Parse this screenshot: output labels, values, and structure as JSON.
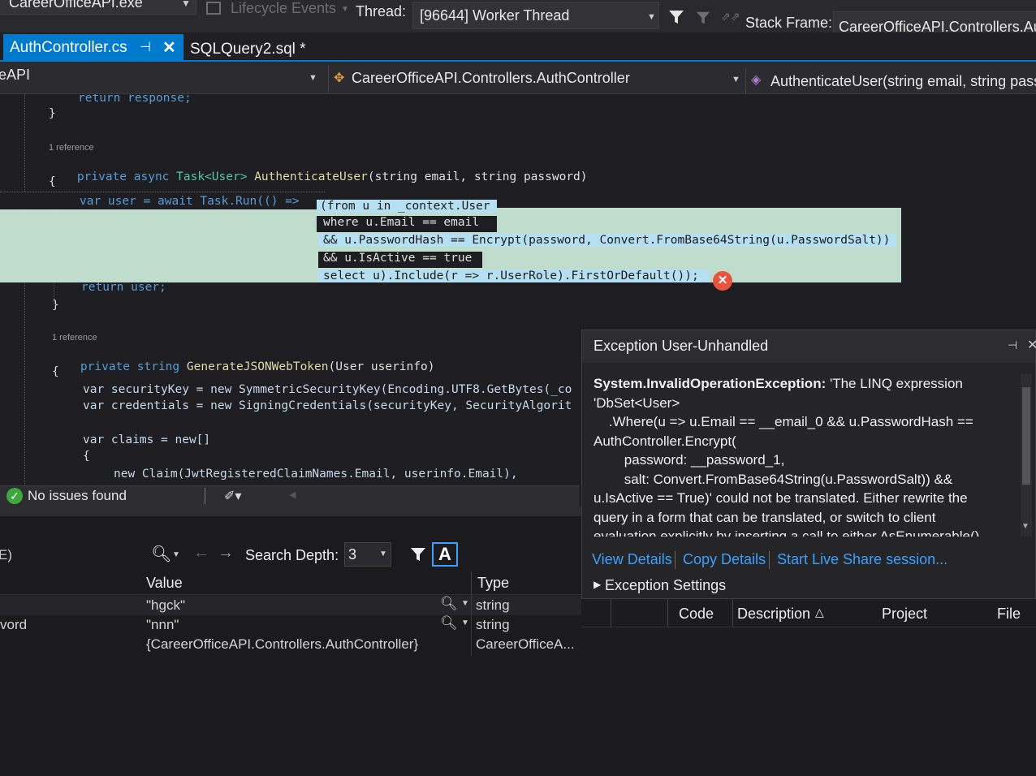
{
  "toolbar": {
    "process": "CareerOfficeAPI.exe",
    "lifecycle_label": "Lifecycle Events",
    "thread_label": "Thread:",
    "thread_value": "[96644] Worker Thread",
    "stack_frame_label": "Stack Frame:",
    "stack_frame_value": "CareerOfficeAPI.Controllers.Auth"
  },
  "tabs": [
    {
      "label": "AuthController.cs",
      "active": true
    },
    {
      "label": "SQLQuery2.sql *",
      "active": false
    }
  ],
  "navbar": {
    "project": "eAPI",
    "class_path": "CareerOfficeAPI.Controllers.AuthController",
    "member": "AuthenticateUser(string email, string passw"
  },
  "code": {
    "return_response": "return response;",
    "brace_close": "}",
    "brace_open": "{",
    "ref_1": "1 reference",
    "auth_sig": {
      "kw_private": "private",
      "kw_async": "async",
      "task_type": "Task<User>",
      "name": "AuthenticateUser",
      "params": "(string email, string password)"
    },
    "line_var_user": "var user = await Task.Run(() =>",
    "line_from": "(from u in _context.User",
    "line_where": "where u.Email == email",
    "line_pwd": "&& u.PasswordHash == Encrypt(password, Convert.FromBase64String(u.PasswordSalt))",
    "line_active": "&& u.IsActive == true",
    "line_select": "select u).Include(r => r.UserRole).FirstOrDefault());",
    "return_user": "return user;",
    "ref_2": "1 reference",
    "gen_sig": {
      "kw_private": "private",
      "kw_string": "string",
      "name": "GenerateJSONWebToken",
      "params": "(User userinfo)"
    },
    "line_seckey": "var securityKey = new SymmetricSecurityKey(Encoding.UTF8.GetBytes(_co",
    "line_creds": "var credentials = new SigningCredentials(securityKey, SecurityAlgorit",
    "line_claims": "var claims = new[]",
    "line_claim_email": "new Claim(JwtRegisteredClaimNames.Email, userinfo.Email),"
  },
  "status": {
    "issues": "No issues found"
  },
  "locals": {
    "search_depth_label": "Search Depth:",
    "search_depth_value": "3",
    "partial_left": "E)",
    "col_value": "Value",
    "col_type": "Type",
    "rows": [
      {
        "name": "",
        "value": "\"hgck\"",
        "type": "string"
      },
      {
        "name": "vord",
        "value": "\"nnn\"",
        "type": "string"
      },
      {
        "name": "",
        "value": "{CareerOfficeAPI.Controllers.AuthController}",
        "type": "CareerOfficeA..."
      }
    ]
  },
  "exception": {
    "title": "Exception User-Unhandled",
    "type": "System.InvalidOperationException:",
    "message_1": " 'The LINQ expression",
    "lines": [
      "'DbSet<User>",
      "    .Where(u => u.Email == __email_0 && u.PasswordHash ==",
      "AuthController.Encrypt(",
      "        password: __password_1,",
      "        salt: Convert.FromBase64String(u.PasswordSalt)) &&",
      "u.IsActive == True)' could not be translated. Either rewrite the",
      "query in a form that can be translated, or switch to client",
      "evaluation explicitly by inserting a call to either AsEnumerable()"
    ],
    "link_view": "View Details",
    "link_copy": "Copy Details",
    "link_share": "Start Live Share session...",
    "settings": "Exception Settings"
  },
  "errorlist": {
    "col_code": "Code",
    "col_desc": "Description",
    "col_project": "Project",
    "col_file": "File"
  },
  "colors": {
    "accent": "#007acc",
    "selection": "#b5dff2",
    "keyword": "#569cd6",
    "type": "#4ec9b0",
    "method": "#dcdcaa",
    "error": "#e8553e",
    "ok": "#3ea83e"
  }
}
